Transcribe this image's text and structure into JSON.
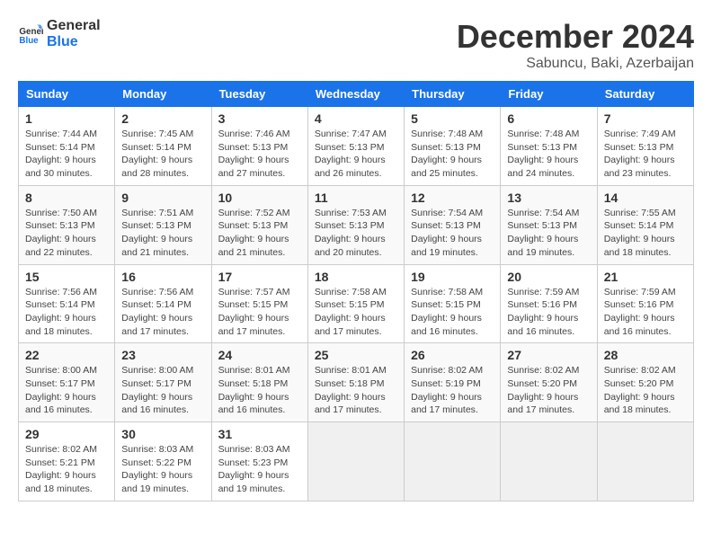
{
  "logo": {
    "line1": "General",
    "line2": "Blue"
  },
  "title": "December 2024",
  "subtitle": "Sabuncu, Baki, Azerbaijan",
  "weekdays": [
    "Sunday",
    "Monday",
    "Tuesday",
    "Wednesday",
    "Thursday",
    "Friday",
    "Saturday"
  ],
  "weeks": [
    [
      {
        "day": "1",
        "sunrise": "7:44 AM",
        "sunset": "5:14 PM",
        "daylight": "9 hours and 30 minutes."
      },
      {
        "day": "2",
        "sunrise": "7:45 AM",
        "sunset": "5:14 PM",
        "daylight": "9 hours and 28 minutes."
      },
      {
        "day": "3",
        "sunrise": "7:46 AM",
        "sunset": "5:13 PM",
        "daylight": "9 hours and 27 minutes."
      },
      {
        "day": "4",
        "sunrise": "7:47 AM",
        "sunset": "5:13 PM",
        "daylight": "9 hours and 26 minutes."
      },
      {
        "day": "5",
        "sunrise": "7:48 AM",
        "sunset": "5:13 PM",
        "daylight": "9 hours and 25 minutes."
      },
      {
        "day": "6",
        "sunrise": "7:48 AM",
        "sunset": "5:13 PM",
        "daylight": "9 hours and 24 minutes."
      },
      {
        "day": "7",
        "sunrise": "7:49 AM",
        "sunset": "5:13 PM",
        "daylight": "9 hours and 23 minutes."
      }
    ],
    [
      {
        "day": "8",
        "sunrise": "7:50 AM",
        "sunset": "5:13 PM",
        "daylight": "9 hours and 22 minutes."
      },
      {
        "day": "9",
        "sunrise": "7:51 AM",
        "sunset": "5:13 PM",
        "daylight": "9 hours and 21 minutes."
      },
      {
        "day": "10",
        "sunrise": "7:52 AM",
        "sunset": "5:13 PM",
        "daylight": "9 hours and 21 minutes."
      },
      {
        "day": "11",
        "sunrise": "7:53 AM",
        "sunset": "5:13 PM",
        "daylight": "9 hours and 20 minutes."
      },
      {
        "day": "12",
        "sunrise": "7:54 AM",
        "sunset": "5:13 PM",
        "daylight": "9 hours and 19 minutes."
      },
      {
        "day": "13",
        "sunrise": "7:54 AM",
        "sunset": "5:13 PM",
        "daylight": "9 hours and 19 minutes."
      },
      {
        "day": "14",
        "sunrise": "7:55 AM",
        "sunset": "5:14 PM",
        "daylight": "9 hours and 18 minutes."
      }
    ],
    [
      {
        "day": "15",
        "sunrise": "7:56 AM",
        "sunset": "5:14 PM",
        "daylight": "9 hours and 18 minutes."
      },
      {
        "day": "16",
        "sunrise": "7:56 AM",
        "sunset": "5:14 PM",
        "daylight": "9 hours and 17 minutes."
      },
      {
        "day": "17",
        "sunrise": "7:57 AM",
        "sunset": "5:15 PM",
        "daylight": "9 hours and 17 minutes."
      },
      {
        "day": "18",
        "sunrise": "7:58 AM",
        "sunset": "5:15 PM",
        "daylight": "9 hours and 17 minutes."
      },
      {
        "day": "19",
        "sunrise": "7:58 AM",
        "sunset": "5:15 PM",
        "daylight": "9 hours and 16 minutes."
      },
      {
        "day": "20",
        "sunrise": "7:59 AM",
        "sunset": "5:16 PM",
        "daylight": "9 hours and 16 minutes."
      },
      {
        "day": "21",
        "sunrise": "7:59 AM",
        "sunset": "5:16 PM",
        "daylight": "9 hours and 16 minutes."
      }
    ],
    [
      {
        "day": "22",
        "sunrise": "8:00 AM",
        "sunset": "5:17 PM",
        "daylight": "9 hours and 16 minutes."
      },
      {
        "day": "23",
        "sunrise": "8:00 AM",
        "sunset": "5:17 PM",
        "daylight": "9 hours and 16 minutes."
      },
      {
        "day": "24",
        "sunrise": "8:01 AM",
        "sunset": "5:18 PM",
        "daylight": "9 hours and 16 minutes."
      },
      {
        "day": "25",
        "sunrise": "8:01 AM",
        "sunset": "5:18 PM",
        "daylight": "9 hours and 17 minutes."
      },
      {
        "day": "26",
        "sunrise": "8:02 AM",
        "sunset": "5:19 PM",
        "daylight": "9 hours and 17 minutes."
      },
      {
        "day": "27",
        "sunrise": "8:02 AM",
        "sunset": "5:20 PM",
        "daylight": "9 hours and 17 minutes."
      },
      {
        "day": "28",
        "sunrise": "8:02 AM",
        "sunset": "5:20 PM",
        "daylight": "9 hours and 18 minutes."
      }
    ],
    [
      {
        "day": "29",
        "sunrise": "8:02 AM",
        "sunset": "5:21 PM",
        "daylight": "9 hours and 18 minutes."
      },
      {
        "day": "30",
        "sunrise": "8:03 AM",
        "sunset": "5:22 PM",
        "daylight": "9 hours and 19 minutes."
      },
      {
        "day": "31",
        "sunrise": "8:03 AM",
        "sunset": "5:23 PM",
        "daylight": "9 hours and 19 minutes."
      },
      null,
      null,
      null,
      null
    ]
  ]
}
